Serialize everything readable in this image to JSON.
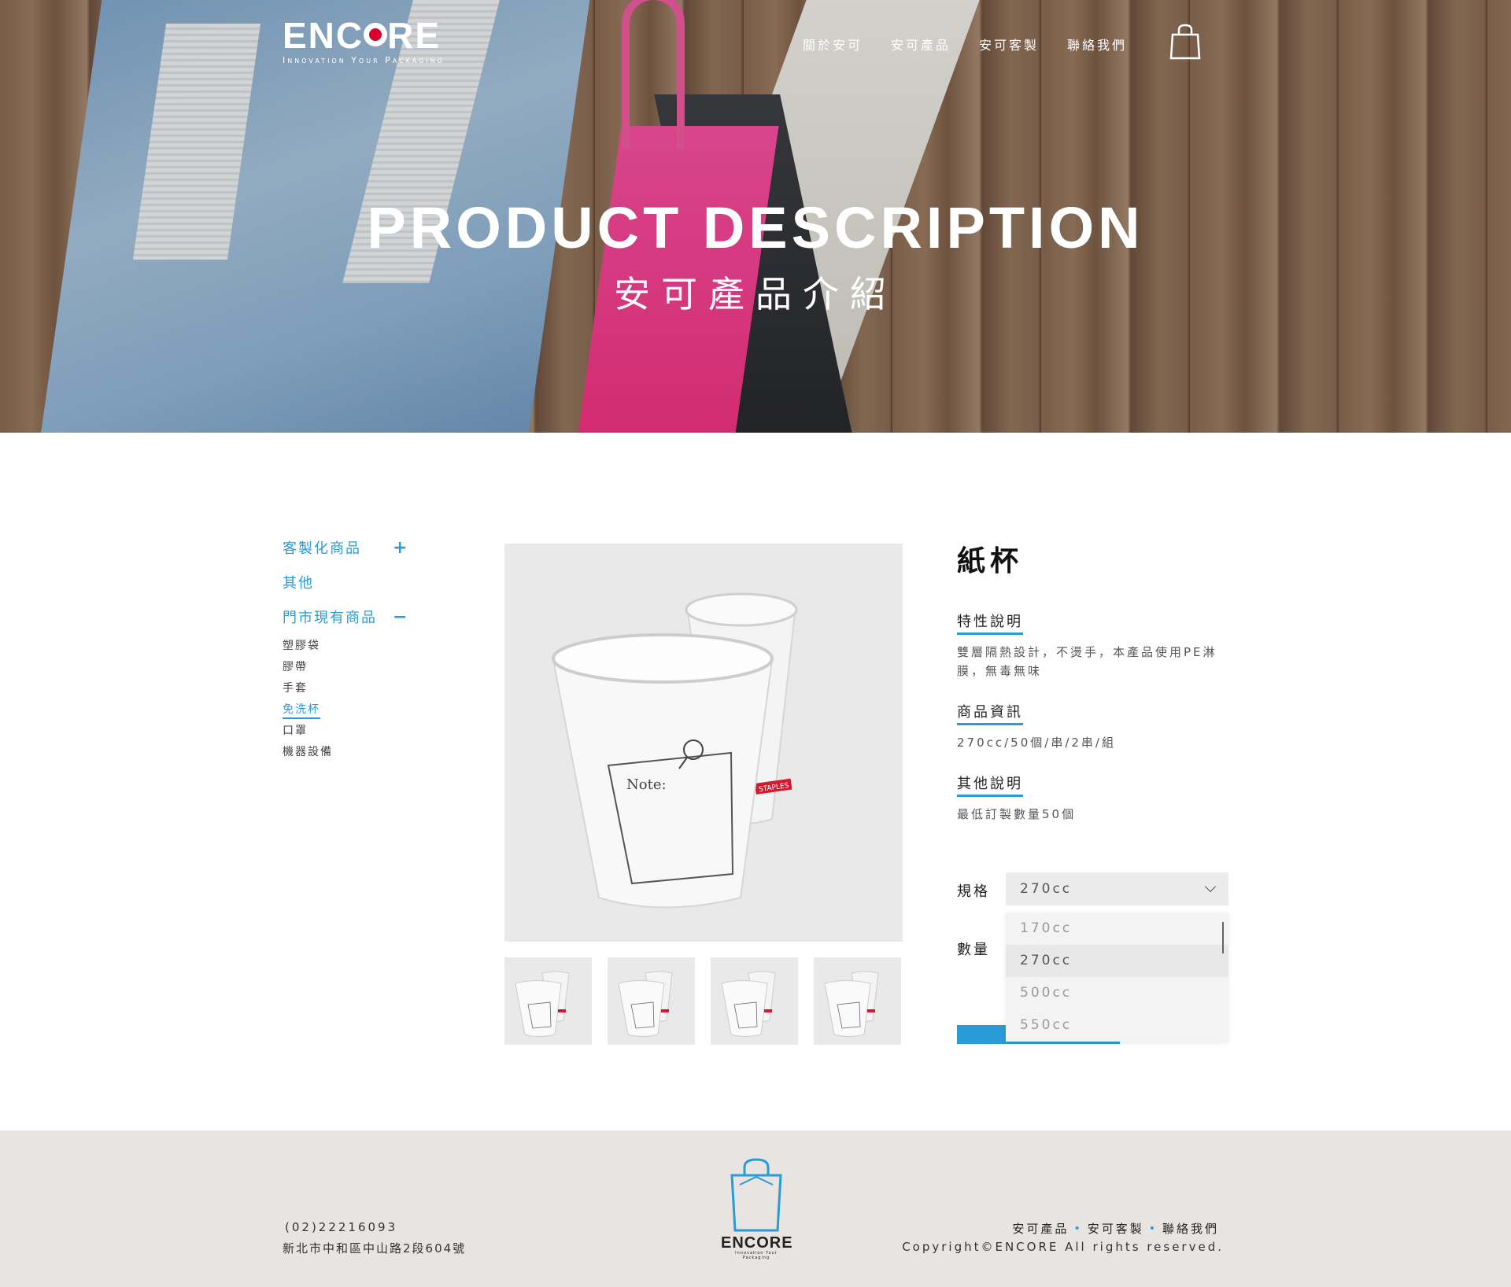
{
  "header": {
    "logo_text": "ENCORE",
    "logo_tagline": "Innovation Your Packaging",
    "nav": [
      "關於安可",
      "安可產品",
      "安可客製",
      "聯絡我們"
    ]
  },
  "hero": {
    "title": "PRODUCT DESCRIPTION",
    "subtitle": "安可產品介紹"
  },
  "sidebar": {
    "categories": [
      {
        "label": "客製化商品",
        "symbol": "+"
      },
      {
        "label": "其他",
        "symbol": ""
      },
      {
        "label": "門市現有商品",
        "symbol": "−"
      }
    ],
    "subitems": [
      "塑膠袋",
      "膠帶",
      "手套",
      "免洗杯",
      "口罩",
      "機器設備"
    ],
    "active_subitem": "免洗杯"
  },
  "product": {
    "title": "紙杯",
    "features_heading": "特性說明",
    "features_text": "雙層隔熱設計，不燙手，本產品使用PE淋膜，無毒無味",
    "info_heading": "商品資訊",
    "info_text": "270cc/50個/串/2串/組",
    "other_heading": "其他說明",
    "other_text": "最低訂製數量50個",
    "image_label_note": "Note:",
    "image_brand": "STAPLES"
  },
  "form": {
    "spec_label": "規格",
    "qty_label": "數量",
    "spec_value": "270cc",
    "spec_options": [
      "170cc",
      "270cc",
      "500cc",
      "550cc"
    ]
  },
  "footer": {
    "phone": "(02)22216093",
    "address": "新北市中和區中山路2段604號",
    "logo_text": "ENCORE",
    "logo_tagline": "Innovation Your Packaging",
    "links": [
      "安可產品",
      "安可客製",
      "聯絡我們"
    ],
    "copyright": "Copyright©ENCORE All rights reserved."
  },
  "colors": {
    "accent": "#2a9bd6",
    "logo_red": "#d8002b",
    "footer_bg": "#e7e4e1"
  }
}
